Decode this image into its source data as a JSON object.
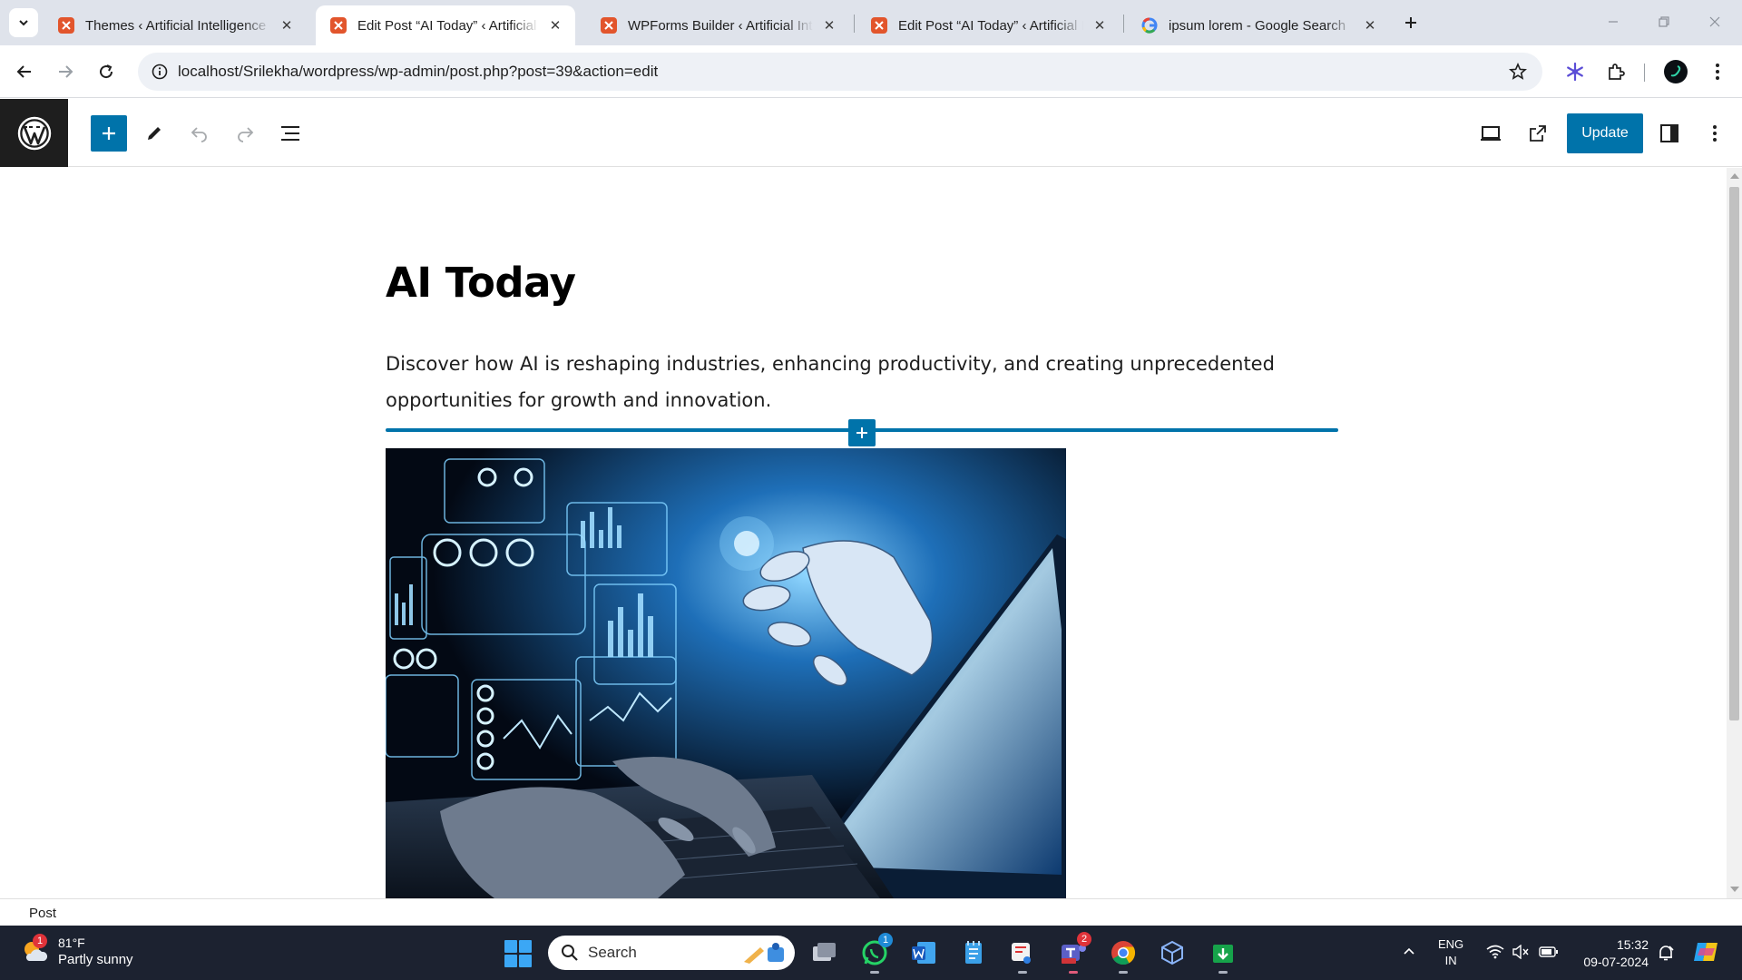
{
  "browser": {
    "tabs": [
      {
        "title": "Themes ‹ Artificial Intelligence – WordPress",
        "active": false
      },
      {
        "title": "Edit Post “AI Today” ‹ Artificial Intelligence",
        "active": true
      },
      {
        "title": "WPForms Builder ‹ Artificial Intelligence",
        "active": false
      },
      {
        "title": "Edit Post “AI Today” ‹ Artificial Intelligence",
        "active": false
      },
      {
        "title": "ipsum lorem - Google Search",
        "active": false
      }
    ],
    "url": "localhost/Srilekha/wordpress/wp-admin/post.php?post=39&action=edit"
  },
  "editor": {
    "update_label": "Update",
    "post_title": "AI Today",
    "post_paragraph": "Discover how AI is reshaping industries, enhancing productivity, and creating unprecedented opportunities for growth and innovation.",
    "breadcrumb": "Post",
    "accent_color": "#0073aa"
  },
  "taskbar": {
    "weather_temp": "81°F",
    "weather_desc": "Partly sunny",
    "weather_badge": "1",
    "search_label": "Search",
    "whatsapp_badge": "1",
    "teams_badge": "2",
    "lang_primary": "ENG",
    "lang_secondary": "IN",
    "time": "15:32",
    "date": "09-07-2024"
  }
}
